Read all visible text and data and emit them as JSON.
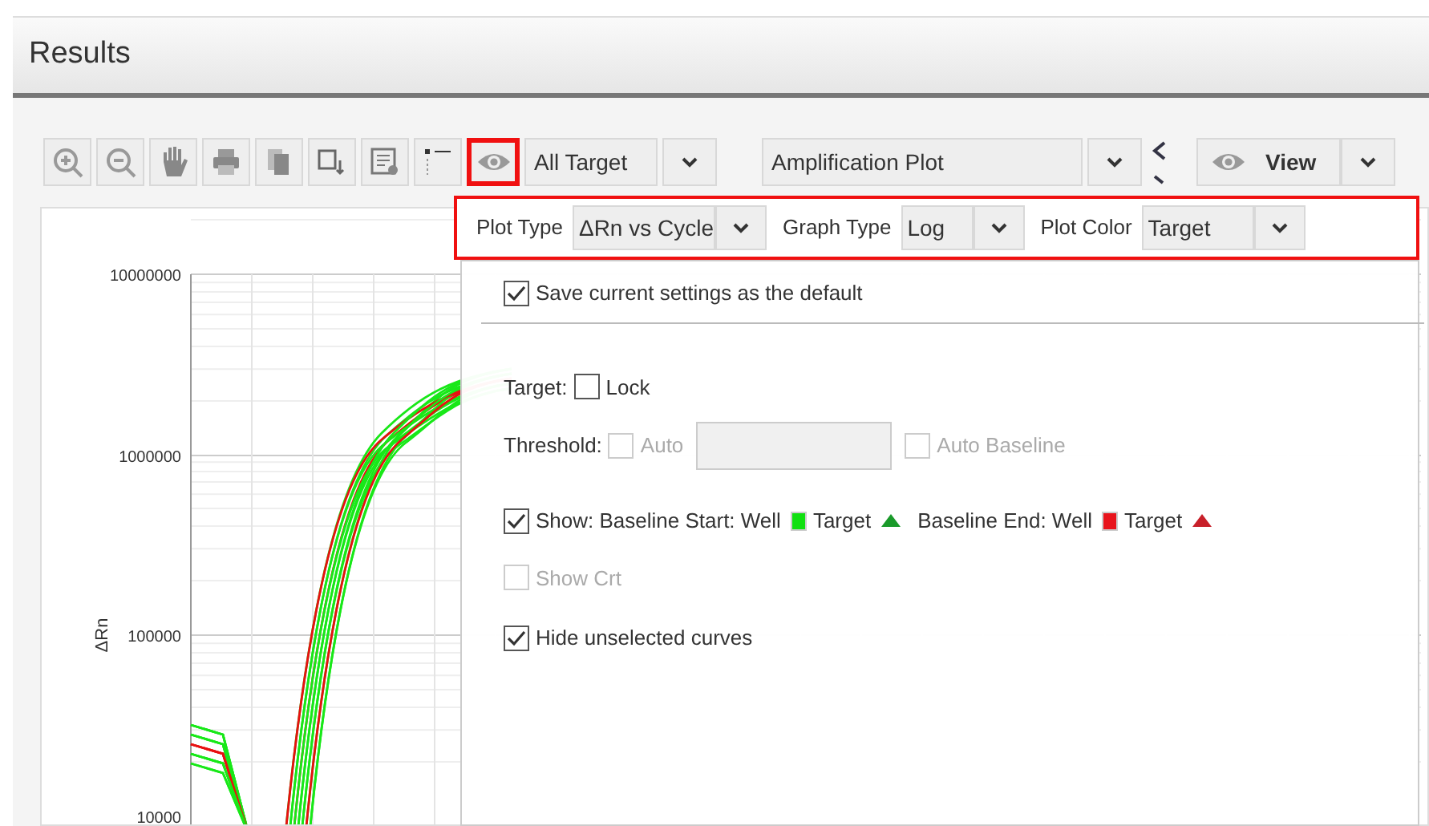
{
  "panel": {
    "title": "Results"
  },
  "toolbar": {
    "visibility_button": {
      "highlighted": true
    },
    "target_select": {
      "value": "All Target"
    },
    "plot_select": {
      "value": "Amplification Plot"
    },
    "view_button": {
      "label": "View"
    }
  },
  "plot_options": {
    "highlighted": true,
    "fields": [
      {
        "label": "Plot Type",
        "value": "ΔRn vs Cycle"
      },
      {
        "label": "Graph Type",
        "value": "Log"
      },
      {
        "label": "Plot Color",
        "value": "Target"
      }
    ]
  },
  "settings": {
    "save_default": {
      "label": "Save current settings as the default",
      "checked": true,
      "disabled": false
    },
    "target": {
      "label": "Target:",
      "lock": {
        "label": "Lock",
        "checked": false,
        "disabled": false
      }
    },
    "threshold": {
      "label": "Threshold:",
      "auto": {
        "label": "Auto",
        "checked": false,
        "disabled": true
      },
      "value_field": {
        "disabled": true
      },
      "auto_baseline": {
        "label": "Auto Baseline",
        "checked": false,
        "disabled": true
      }
    },
    "show_baseline": {
      "checked": true,
      "disabled": false,
      "items": [
        {
          "kind": "text",
          "text": "Show: Baseline Start: Well"
        },
        {
          "kind": "well",
          "color": "#10e010"
        },
        {
          "kind": "text",
          "text": "Target"
        },
        {
          "kind": "triangle",
          "color": "#1a9a2a"
        },
        {
          "kind": "text",
          "text": "Baseline End: Well"
        },
        {
          "kind": "well",
          "color": "#e8141c"
        },
        {
          "kind": "text",
          "text": "Target"
        },
        {
          "kind": "triangle",
          "color": "#c8202a"
        }
      ]
    },
    "show_crt": {
      "label": "Show Crt",
      "checked": false,
      "disabled": true
    },
    "hide_unselected": {
      "label": "Hide unselected curves",
      "checked": true,
      "disabled": false
    }
  },
  "chart": {
    "ylabel": "ΔRn",
    "ytick_labels": [
      "10000000",
      "1000000",
      "100000",
      "10000"
    ]
  }
}
